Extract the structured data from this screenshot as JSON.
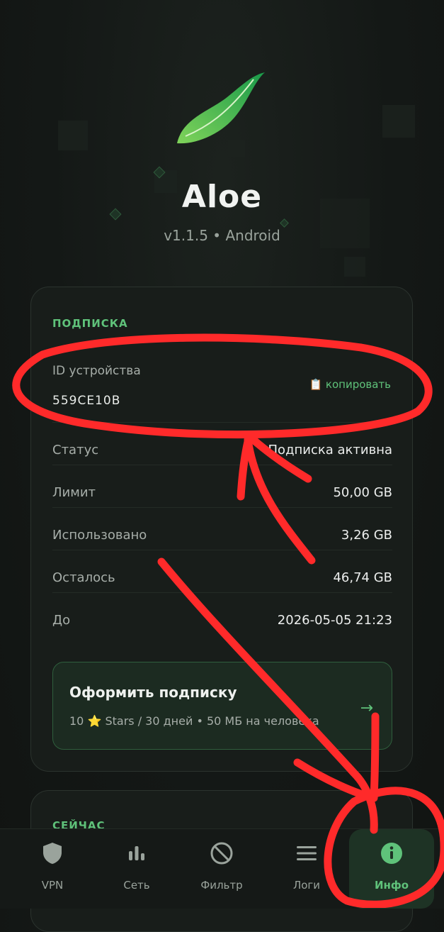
{
  "app": {
    "title": "Aloe",
    "version": "v1.1.5 • Android"
  },
  "subscription": {
    "section_title": "ПОДПИСКА",
    "device_id_label": "ID устройства",
    "device_id": "559CE10B",
    "copy_label": "📋 копировать",
    "rows": [
      {
        "label": "Статус",
        "value": "Подписка активна"
      },
      {
        "label": "Лимит",
        "value": "50,00 GB"
      },
      {
        "label": "Использовано",
        "value": "3,26 GB"
      },
      {
        "label": "Осталось",
        "value": "46,74 GB"
      },
      {
        "label": "До",
        "value": "2026-05-05 21:23"
      }
    ],
    "purchase": {
      "title": "Оформить подписку",
      "description": "10 ⭐ Stars / 30 дней • 50 МБ на человека",
      "arrow": "→"
    }
  },
  "now": {
    "section_title": "СЕЙЧАС"
  },
  "nav": [
    {
      "label": "VPN",
      "icon": "shield-icon"
    },
    {
      "label": "Сеть",
      "icon": "bar-chart-icon"
    },
    {
      "label": "Фильтр",
      "icon": "block-icon"
    },
    {
      "label": "Логи",
      "icon": "menu-lines-icon"
    },
    {
      "label": "Инфо",
      "icon": "info-icon",
      "active": true
    }
  ],
  "colors": {
    "accent": "#5fc27a",
    "background": "#141816",
    "annotation": "#ff2a2a"
  }
}
